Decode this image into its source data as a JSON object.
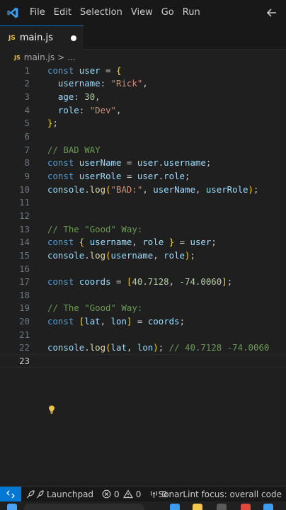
{
  "menu": {
    "items": [
      "File",
      "Edit",
      "Selection",
      "View",
      "Go",
      "Run"
    ]
  },
  "tab": {
    "icon_text": "JS",
    "label": "main.js"
  },
  "breadcrumb": {
    "icon_text": "JS",
    "file": "main.js",
    "separator": ">",
    "more": "..."
  },
  "editor": {
    "active_line": "23",
    "line_numbers": [
      "1",
      "2",
      "3",
      "4",
      "5",
      "6",
      "7",
      "8",
      "9",
      "10",
      "11",
      "12",
      "13",
      "14",
      "15",
      "16",
      "17",
      "18",
      "19",
      "20",
      "21",
      "22",
      "23"
    ],
    "lines": [
      [
        [
          "kw",
          "const"
        ],
        [
          "pun",
          " "
        ],
        [
          "var",
          "user"
        ],
        [
          "pun",
          " = "
        ],
        [
          "br1",
          "{"
        ]
      ],
      [
        [
          "pun",
          "  "
        ],
        [
          "prop",
          "username"
        ],
        [
          "pun",
          ": "
        ],
        [
          "str",
          "\"Rick\""
        ],
        [
          "pun",
          ","
        ]
      ],
      [
        [
          "pun",
          "  "
        ],
        [
          "prop",
          "age"
        ],
        [
          "pun",
          ": "
        ],
        [
          "num",
          "30"
        ],
        [
          "pun",
          ","
        ]
      ],
      [
        [
          "pun",
          "  "
        ],
        [
          "prop",
          "role"
        ],
        [
          "pun",
          ": "
        ],
        [
          "str",
          "\"Dev\""
        ],
        [
          "pun",
          ","
        ]
      ],
      [
        [
          "br1",
          "}"
        ],
        [
          "pun",
          ";"
        ]
      ],
      [],
      [
        [
          "cmt",
          "// BAD WAY"
        ]
      ],
      [
        [
          "kw",
          "const"
        ],
        [
          "pun",
          " "
        ],
        [
          "var",
          "userName"
        ],
        [
          "pun",
          " = "
        ],
        [
          "var",
          "user"
        ],
        [
          "pun",
          "."
        ],
        [
          "prop",
          "username"
        ],
        [
          "pun",
          ";"
        ]
      ],
      [
        [
          "kw",
          "const"
        ],
        [
          "pun",
          " "
        ],
        [
          "var",
          "userRole"
        ],
        [
          "pun",
          " = "
        ],
        [
          "var",
          "user"
        ],
        [
          "pun",
          "."
        ],
        [
          "prop",
          "role"
        ],
        [
          "pun",
          ";"
        ]
      ],
      [
        [
          "var",
          "console"
        ],
        [
          "pun",
          "."
        ],
        [
          "fn",
          "log"
        ],
        [
          "br1",
          "("
        ],
        [
          "str",
          "\"BAD:\""
        ],
        [
          "pun",
          ", "
        ],
        [
          "var",
          "userName"
        ],
        [
          "pun",
          ", "
        ],
        [
          "var",
          "userRole"
        ],
        [
          "br1",
          ")"
        ],
        [
          "pun",
          ";"
        ]
      ],
      [],
      [],
      [
        [
          "cmt",
          "// The \"Good\" Way:"
        ]
      ],
      [
        [
          "kw",
          "const"
        ],
        [
          "pun",
          " "
        ],
        [
          "br1",
          "{"
        ],
        [
          "pun",
          " "
        ],
        [
          "var",
          "username"
        ],
        [
          "pun",
          ", "
        ],
        [
          "var",
          "role"
        ],
        [
          "pun",
          " "
        ],
        [
          "br1",
          "}"
        ],
        [
          "pun",
          " = "
        ],
        [
          "var",
          "user"
        ],
        [
          "pun",
          ";"
        ]
      ],
      [
        [
          "var",
          "console"
        ],
        [
          "pun",
          "."
        ],
        [
          "fn",
          "log"
        ],
        [
          "br1",
          "("
        ],
        [
          "var",
          "username"
        ],
        [
          "pun",
          ", "
        ],
        [
          "var",
          "role"
        ],
        [
          "br1",
          ")"
        ],
        [
          "pun",
          ";"
        ]
      ],
      [],
      [
        [
          "kw",
          "const"
        ],
        [
          "pun",
          " "
        ],
        [
          "var",
          "coords"
        ],
        [
          "pun",
          " = "
        ],
        [
          "br1",
          "["
        ],
        [
          "num",
          "40.7128"
        ],
        [
          "pun",
          ", "
        ],
        [
          "num",
          "-74.0060"
        ],
        [
          "br1",
          "]"
        ],
        [
          "pun",
          ";"
        ]
      ],
      [],
      [
        [
          "cmt",
          "// The \"Good\" Way:"
        ]
      ],
      [
        [
          "kw",
          "const"
        ],
        [
          "pun",
          " "
        ],
        [
          "br1",
          "["
        ],
        [
          "var",
          "lat"
        ],
        [
          "pun",
          ", "
        ],
        [
          "var",
          "lon"
        ],
        [
          "br1",
          "]"
        ],
        [
          "pun",
          " = "
        ],
        [
          "var",
          "coords"
        ],
        [
          "pun",
          ";"
        ]
      ],
      [],
      [
        [
          "var",
          "console"
        ],
        [
          "pun",
          "."
        ],
        [
          "fn",
          "log"
        ],
        [
          "br1",
          "("
        ],
        [
          "var",
          "lat"
        ],
        [
          "pun",
          ", "
        ],
        [
          "var",
          "lon"
        ],
        [
          "br1",
          ")"
        ],
        [
          "pun",
          "; "
        ],
        [
          "cmt",
          "// 40.7128 -74.0060"
        ]
      ],
      []
    ]
  },
  "statusbar": {
    "launchpad": "Launchpad",
    "errors": "0",
    "warnings": "0",
    "ports": "0",
    "sonarlint": "SonarLint focus: overall code"
  },
  "colors": {
    "accent": "#0078d4",
    "background": "#1f1f1f",
    "chrome": "#181818"
  }
}
